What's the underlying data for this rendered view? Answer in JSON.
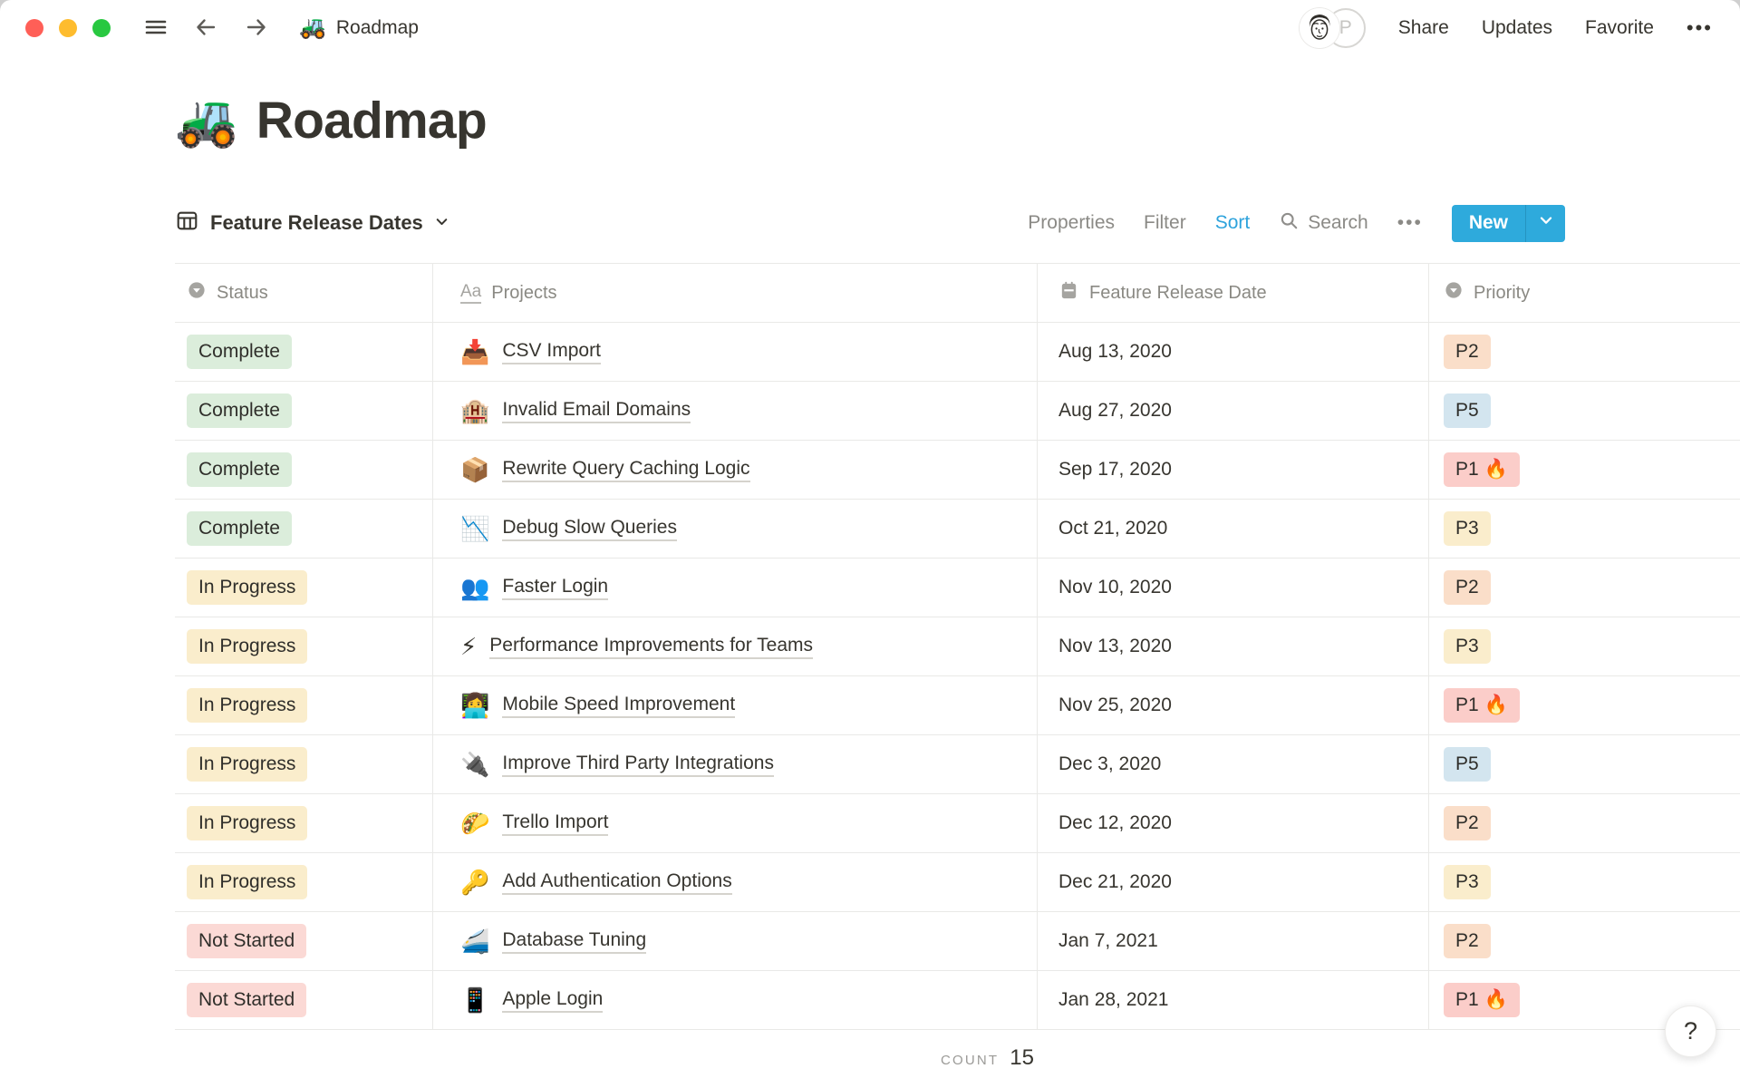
{
  "topbar": {
    "breadcrumb": {
      "icon": "🚜",
      "title": "Roadmap"
    },
    "avatar_letter": "P",
    "share": "Share",
    "updates": "Updates",
    "favorite": "Favorite",
    "more": "•••"
  },
  "page": {
    "icon": "🚜",
    "title": "Roadmap"
  },
  "view_bar": {
    "view_name": "Feature Release Dates",
    "properties": "Properties",
    "filter": "Filter",
    "sort": "Sort",
    "search_label": "Search",
    "more": "•••",
    "new_label": "New"
  },
  "table": {
    "columns": [
      {
        "label": "Status",
        "icon": "select-icon"
      },
      {
        "label": "Projects",
        "icon": "title-icon"
      },
      {
        "label": "Feature Release Date",
        "icon": "calendar-icon"
      },
      {
        "label": "Priority",
        "icon": "select-icon"
      }
    ],
    "rows": [
      {
        "status": "Complete",
        "status_color": "green",
        "icon": "📥",
        "project": "CSV Import",
        "date": "Aug 13, 2020",
        "priority": "P2",
        "priority_color": "orange"
      },
      {
        "status": "Complete",
        "status_color": "green",
        "icon": "🏨",
        "project": "Invalid Email Domains",
        "date": "Aug 27, 2020",
        "priority": "P5",
        "priority_color": "blue"
      },
      {
        "status": "Complete",
        "status_color": "green",
        "icon": "📦",
        "project": "Rewrite Query Caching Logic",
        "date": "Sep 17, 2020",
        "priority": "P1 🔥",
        "priority_color": "red"
      },
      {
        "status": "Complete",
        "status_color": "green",
        "icon": "📉",
        "project": "Debug Slow Queries",
        "date": "Oct 21, 2020",
        "priority": "P3",
        "priority_color": "yellow"
      },
      {
        "status": "In Progress",
        "status_color": "yellow",
        "icon": "👥",
        "project": "Faster Login",
        "date": "Nov 10, 2020",
        "priority": "P2",
        "priority_color": "orange"
      },
      {
        "status": "In Progress",
        "status_color": "yellow",
        "icon": "⚡",
        "project": "Performance Improvements for Teams",
        "date": "Nov 13, 2020",
        "priority": "P3",
        "priority_color": "yellow"
      },
      {
        "status": "In Progress",
        "status_color": "yellow",
        "icon": "👩‍💻",
        "project": "Mobile Speed Improvement",
        "date": "Nov 25, 2020",
        "priority": "P1 🔥",
        "priority_color": "red"
      },
      {
        "status": "In Progress",
        "status_color": "yellow",
        "icon": "🔌",
        "project": "Improve Third Party Integrations",
        "date": "Dec 3, 2020",
        "priority": "P5",
        "priority_color": "blue"
      },
      {
        "status": "In Progress",
        "status_color": "yellow",
        "icon": "🌮",
        "project": "Trello Import",
        "date": "Dec 12, 2020",
        "priority": "P2",
        "priority_color": "orange"
      },
      {
        "status": "In Progress",
        "status_color": "yellow",
        "icon": "🔑",
        "project": "Add Authentication Options",
        "date": "Dec 21, 2020",
        "priority": "P3",
        "priority_color": "yellow"
      },
      {
        "status": "Not Started",
        "status_color": "pink",
        "icon": "🚄",
        "project": "Database Tuning",
        "date": "Jan 7, 2021",
        "priority": "P2",
        "priority_color": "orange"
      },
      {
        "status": "Not Started",
        "status_color": "pink",
        "icon": "📱",
        "project": "Apple Login",
        "date": "Jan 28, 2021",
        "priority": "P1 🔥",
        "priority_color": "red"
      }
    ],
    "footer": {
      "count_label": "COUNT",
      "count_value": "15"
    }
  },
  "help_button": "?",
  "colors": {
    "accent_blue": "#2EAADC",
    "sort_active": "#2EA3DC",
    "traffic_red": "#FF5F57",
    "traffic_yellow": "#FEBC2E",
    "traffic_green": "#28C840",
    "badge_green": "#DBEDDB",
    "badge_yellow": "#FAEDCC",
    "badge_pink": "#FBD9D5",
    "badge_orange": "#FADEC9",
    "badge_blue": "#D3E5EF",
    "badge_red": "#FBCDC9"
  }
}
